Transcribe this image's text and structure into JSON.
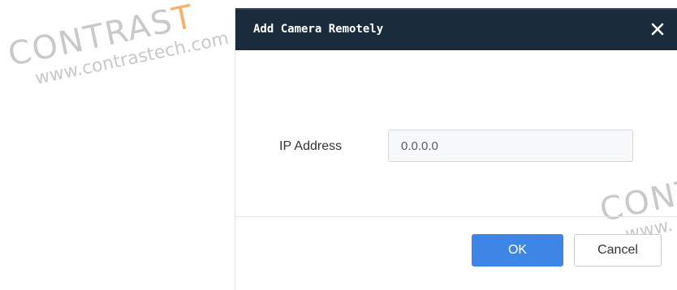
{
  "watermark": {
    "brand_prefix": "CONTRAS",
    "brand_accent": "T",
    "brand_suffix": "",
    "url": "www.contrastech.com",
    "brand_right": "CONT",
    "url_right": "www.",
    "accent_color": "#f6b26b"
  },
  "dialog": {
    "title": "Add Camera Remotely",
    "close_icon": "close-icon",
    "header_color": "#1a2b3c"
  },
  "form": {
    "ip_label": "IP Address",
    "ip_value": "0.0.0.0"
  },
  "footer": {
    "ok_label": "OK",
    "cancel_label": "Cancel",
    "ok_color": "#3d86e6"
  }
}
